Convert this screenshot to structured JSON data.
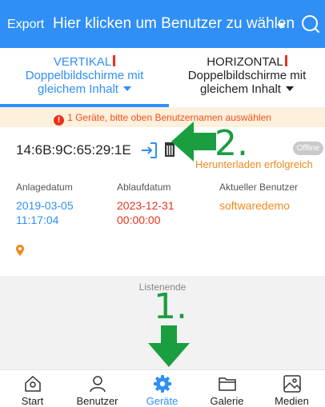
{
  "topbar": {
    "export_label": "Export",
    "user_select_label": "Hier klicken um Benutzer zu wählen",
    "search_icon": "search-icon"
  },
  "tabs": [
    {
      "line1": "VERTIKAL",
      "line2": "Doppelbildschirme mit",
      "line3": "gleichem Inhalt",
      "active": true
    },
    {
      "line1": "HORIZONTAL",
      "line2": "Doppelbildschirme mit",
      "line3": "gleichem Inhalt",
      "active": false
    }
  ],
  "warning": {
    "text": "1 Geräte, bitte oben Benutzernamen auswählen",
    "icon": "!"
  },
  "device": {
    "mac": "14:6B:9C:65:29:1E",
    "status": "Offline",
    "download_status": "Herunterladen erfolgreich",
    "fields": [
      {
        "label": "Anlagedatum",
        "value_line1": "2019-03-05",
        "value_line2": "11:17:04",
        "color": "#2f8ff5"
      },
      {
        "label": "Ablaufdatum",
        "value_line1": "2023-12-31",
        "value_line2": "00:00:00",
        "color": "#e8321e"
      },
      {
        "label": "Aktueller Benutzer",
        "value_line1": "softwaredemo",
        "value_line2": "",
        "color": "#f08a1a"
      }
    ]
  },
  "list_end": "Listenende",
  "annotations": {
    "step1": "1.",
    "step2": "2.",
    "color": "#1a9e3f"
  },
  "nav": [
    {
      "label": "Start",
      "icon": "home-icon",
      "active": false
    },
    {
      "label": "Benutzer",
      "icon": "user-icon",
      "active": false
    },
    {
      "label": "Geräte",
      "icon": "gear-icon",
      "active": true
    },
    {
      "label": "Galerie",
      "icon": "folder-icon",
      "active": false
    },
    {
      "label": "Medien",
      "icon": "image-icon",
      "active": false
    }
  ],
  "colors": {
    "primary": "#2f8ff5",
    "danger": "#e8321e",
    "warning": "#f08a1a"
  }
}
